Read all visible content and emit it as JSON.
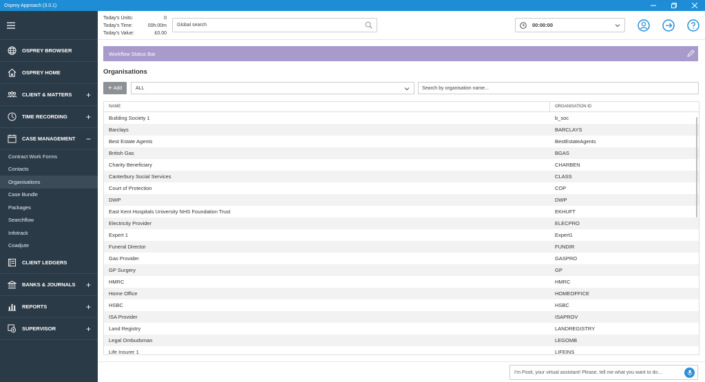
{
  "window": {
    "title": "Osprey Approach (3.0.1)"
  },
  "sidebar": {
    "nav": [
      {
        "label": "OSPREY BROWSER",
        "icon": "globe-icon",
        "plus": ""
      },
      {
        "label": "OSPREY HOME",
        "icon": "home-icon",
        "plus": ""
      },
      {
        "label": "CLIENT & MATTERS",
        "icon": "people-icon",
        "plus": "+"
      },
      {
        "label": "TIME RECORDING",
        "icon": "stopwatch-icon",
        "plus": "+"
      },
      {
        "label": "CASE MANAGEMENT",
        "icon": "calendar-icon",
        "plus": "−"
      }
    ],
    "sub_items": [
      "Contract Work Forms",
      "Contacts",
      "Organisations",
      "Case Bundle",
      "Packages",
      "Searchflow",
      "Infotrack",
      "Coadjute"
    ],
    "nav_bottom": [
      {
        "label": "CLIENT LEDGERS",
        "icon": "ledger-icon",
        "plus": ""
      },
      {
        "label": "BANKS & JOURNALS",
        "icon": "bank-icon",
        "plus": "+"
      },
      {
        "label": "REPORTS",
        "icon": "bar-chart-icon",
        "plus": "+"
      },
      {
        "label": "SUPERVISOR",
        "icon": "supervisor-icon",
        "plus": "+"
      }
    ]
  },
  "header": {
    "stats": [
      {
        "label": "Today's Units:",
        "value": "0"
      },
      {
        "label": "Today's Time:",
        "value": "00h:00m"
      },
      {
        "label": "Today's Value:",
        "value": "£0.00"
      }
    ],
    "global_search_placeholder": "Global search",
    "timer": "00:00:00"
  },
  "main": {
    "status_bar": "Workflow Status Bar",
    "page_title": "Organisations",
    "add_label": "Add",
    "filter_value": "ALL",
    "search_placeholder": "Search by organisation name...",
    "columns": [
      "NAME",
      "ORGANISATION ID"
    ],
    "rows": [
      [
        "Building Society 1",
        "b_soc"
      ],
      [
        "Barclays",
        "BARCLAYS"
      ],
      [
        "Best Estate Agents",
        "BestEstateAgents"
      ],
      [
        "British Gas",
        "BGAS"
      ],
      [
        "Charity Beneficiary",
        "CHARBEN"
      ],
      [
        "Canterbury Social Services",
        "CLASS"
      ],
      [
        "Court of Protection",
        "COP"
      ],
      [
        "DWP",
        "DWP"
      ],
      [
        "East Kent Hospitals University NHS Foundation Trust",
        "EKHUFT"
      ],
      [
        "Electricity Provider",
        "ELECPRO"
      ],
      [
        "Expert 1",
        "Expert1"
      ],
      [
        "Funeral Director",
        "FUNDIR"
      ],
      [
        "Gas Provider",
        "GASPRO"
      ],
      [
        "GP Surgery",
        "GP"
      ],
      [
        "HMRC",
        "HMRC"
      ],
      [
        "Home Office",
        "HOMEOFFICE"
      ],
      [
        "HSBC",
        "HSBC"
      ],
      [
        "ISA Provider",
        "ISAPROV"
      ],
      [
        "Land Registry",
        "LANDREGISTRY"
      ],
      [
        "Legal Ombudsman",
        "LEGOMB"
      ],
      [
        "Life Insurer 1",
        "LIFEINS"
      ]
    ]
  },
  "footer": {
    "assistant_placeholder": "I'm Posit, your virtual assistant! Please, tell me what you want to do..."
  },
  "colors": {
    "titlebar": "#1f8dd6",
    "sidebar": "#2b3a47",
    "status_bar": "#a89bcc",
    "accent": "#1f8dd6"
  }
}
